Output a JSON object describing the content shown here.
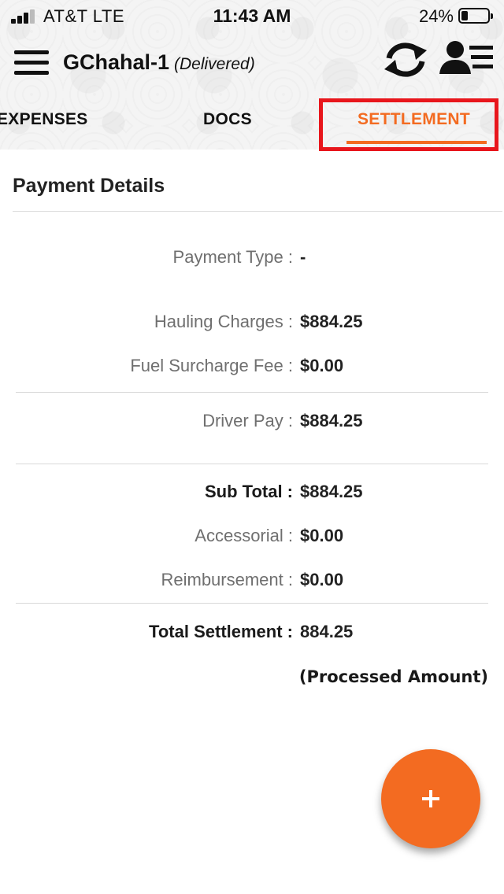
{
  "status_bar": {
    "carrier": "AT&T   LTE",
    "time": "11:43 AM",
    "battery_percent": "24%",
    "battery_level": 0.24,
    "signal_bars_filled": 3,
    "signal_bars_total": 4
  },
  "app_bar": {
    "load_name": "GChahal-1",
    "load_status": "(Delivered)",
    "icons": [
      "menu-icon",
      "sync-icon",
      "driver-profile-icon"
    ]
  },
  "tabs": [
    {
      "label": "EXPENSES",
      "active": false
    },
    {
      "label": "DOCS",
      "active": false
    },
    {
      "label": "SETTLEMENT",
      "active": true
    }
  ],
  "colors": {
    "accent": "#f36b21",
    "highlight_box": "#e8161c"
  },
  "payment_details": {
    "title": "Payment Details",
    "payment_type": {
      "label": "Payment Type :",
      "value": "-"
    },
    "hauling_charges": {
      "label": "Hauling Charges :",
      "value": "$884.25"
    },
    "fuel_surcharge": {
      "label": "Fuel Surcharge Fee :",
      "value": "$0.00"
    },
    "driver_pay": {
      "label": "Driver Pay :",
      "value": "$884.25"
    },
    "sub_total": {
      "label": "Sub Total :",
      "value": "$884.25"
    },
    "accessorial": {
      "label": "Accessorial :",
      "value": "$0.00"
    },
    "reimbursement": {
      "label": "Reimbursement :",
      "value": "$0.00"
    },
    "total_settlement": {
      "label": "Total Settlement :",
      "value": "884.25"
    },
    "processed_note": "(Processed Amount)"
  },
  "fab": {
    "icon": "plus-icon"
  }
}
